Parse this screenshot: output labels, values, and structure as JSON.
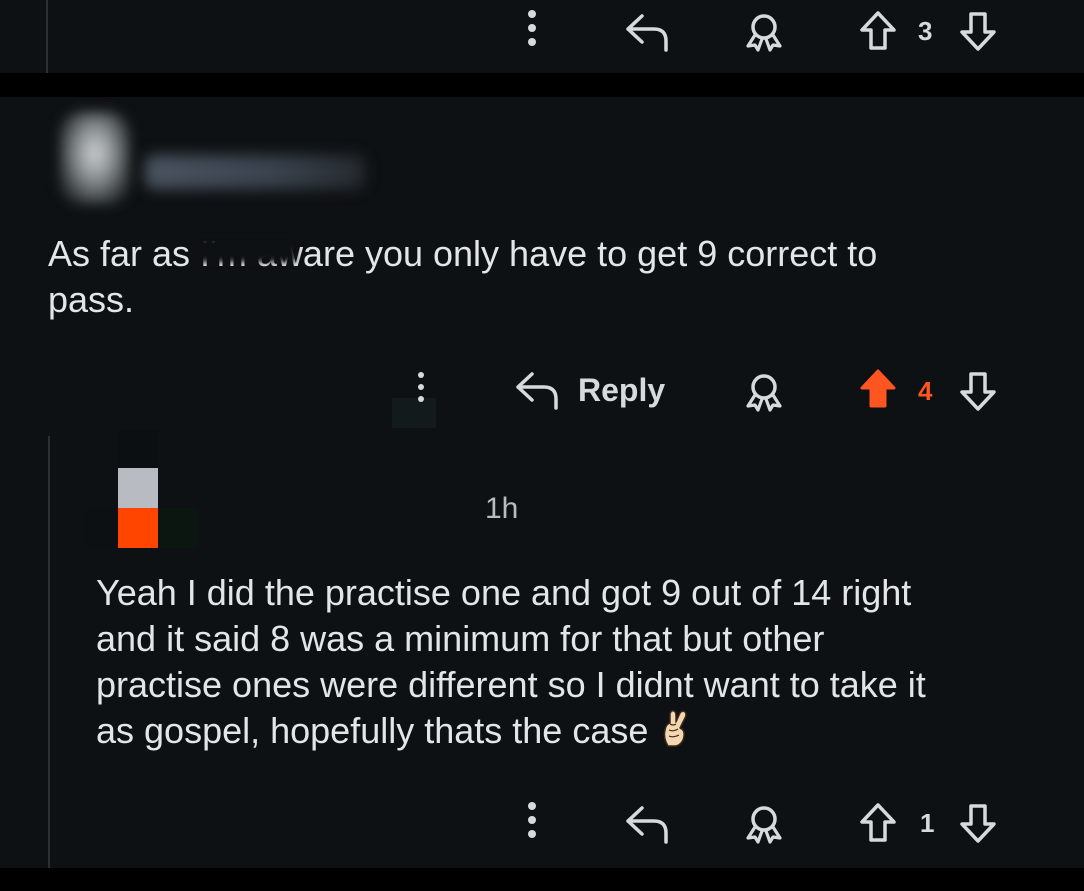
{
  "top_actions": {
    "vote_count": "3"
  },
  "parent_comment": {
    "text_line1": "As far as I'm aware you only have to get 9 correct to",
    "text_line2": "pass.",
    "actions": {
      "reply_label": "Reply",
      "vote_count": "4"
    }
  },
  "reply_comment": {
    "timestamp": "1h",
    "text_lines": [
      "Yeah I did the practise one and got 9 out of 14 right",
      "and it said 8 was a minimum for that but other",
      "practise ones were different so I didnt want to take it",
      "as gospel, hopefully thats the case"
    ],
    "actions": {
      "vote_count": "1"
    }
  },
  "colors": {
    "background": "#0e1113",
    "text": "#d7dadc",
    "upvote_active": "#ff5520",
    "thread_line": "#2a2f33"
  },
  "icons": [
    "more-options-icon",
    "reply-arrow-icon",
    "award-icon",
    "upvote-icon",
    "downvote-icon",
    "crossed-fingers-emoji"
  ]
}
